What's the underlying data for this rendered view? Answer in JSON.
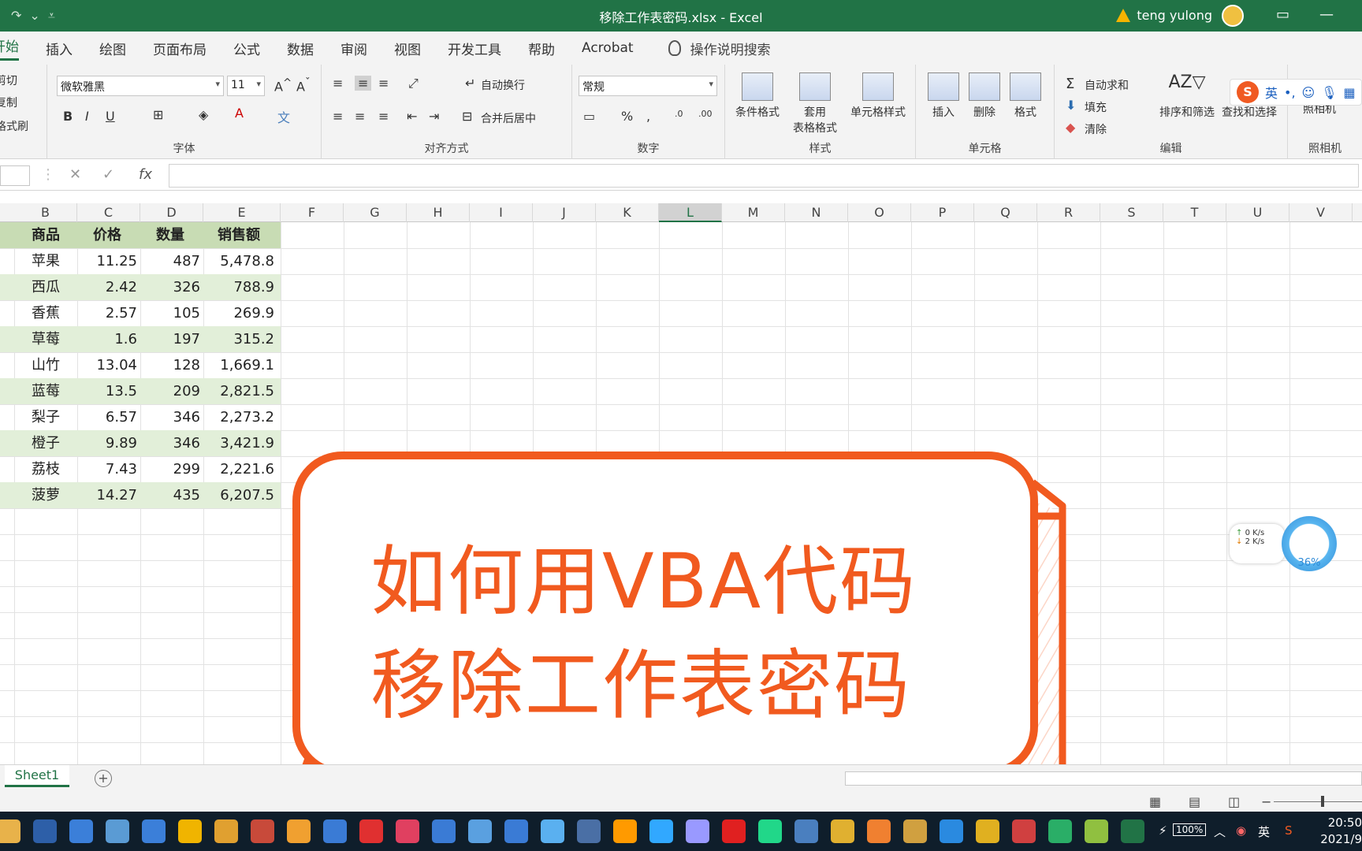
{
  "titlebar": {
    "title": "移除工作表密码.xlsx  -  Excel",
    "user": "teng yulong"
  },
  "tabs": [
    "开始",
    "插入",
    "绘图",
    "页面布局",
    "公式",
    "数据",
    "审阅",
    "视图",
    "开发工具",
    "帮助",
    "Acrobat"
  ],
  "tellme": "操作说明搜索",
  "ribbon": {
    "clipboard": {
      "cut": "剪切",
      "copy": "复制",
      "format_painter": "格式刷"
    },
    "font": {
      "name": "微软雅黑",
      "size": "11",
      "label": "字体"
    },
    "alignment": {
      "wrap": "自动换行",
      "merge": "合并后居中",
      "label": "对齐方式"
    },
    "number": {
      "format": "常规",
      "label": "数字"
    },
    "styles": {
      "conditional": "条件格式",
      "table_a": "套用",
      "table_b": "表格格式",
      "cell_styles": "单元格样式",
      "label": "样式"
    },
    "cells": {
      "insert": "插入",
      "delete": "删除",
      "format": "格式",
      "label": "单元格"
    },
    "editing": {
      "autosum": "自动求和",
      "fill": "填充",
      "clear": "清除",
      "sort": "排序和筛选",
      "find": "查找和选择",
      "label": "编辑"
    },
    "camera": {
      "button": "照相机",
      "label": "照相机"
    },
    "ime": "英"
  },
  "columns": [
    "B",
    "C",
    "D",
    "E",
    "F",
    "G",
    "H",
    "I",
    "J",
    "K",
    "L",
    "M",
    "N",
    "O",
    "P",
    "Q",
    "R",
    "S",
    "T",
    "U",
    "V"
  ],
  "table": {
    "headers": [
      "商品",
      "价格",
      "数量",
      "销售额"
    ],
    "rows": [
      [
        "苹果",
        "11.25",
        "487",
        "5,478.8"
      ],
      [
        "西瓜",
        "2.42",
        "326",
        "788.9"
      ],
      [
        "香蕉",
        "2.57",
        "105",
        "269.9"
      ],
      [
        "草莓",
        "1.6",
        "197",
        "315.2"
      ],
      [
        "山竹",
        "13.04",
        "128",
        "1,669.1"
      ],
      [
        "蓝莓",
        "13.5",
        "209",
        "2,821.5"
      ],
      [
        "梨子",
        "6.57",
        "346",
        "2,273.2"
      ],
      [
        "橙子",
        "9.89",
        "346",
        "3,421.9"
      ],
      [
        "荔枝",
        "7.43",
        "299",
        "2,221.6"
      ],
      [
        "菠萝",
        "14.27",
        "435",
        "6,207.5"
      ]
    ]
  },
  "overlay": {
    "line1": "如何用VBA代码",
    "line2": "移除工作表密码",
    "accent": "#f15a1f"
  },
  "net_widget": {
    "up": "0  K/s",
    "down": "2  K/s",
    "percent": "36%"
  },
  "sheets": [
    "Sheet1"
  ],
  "taskbar": {
    "battery": "100%",
    "ime": "英",
    "time": "20:50",
    "date": "2021/9"
  }
}
